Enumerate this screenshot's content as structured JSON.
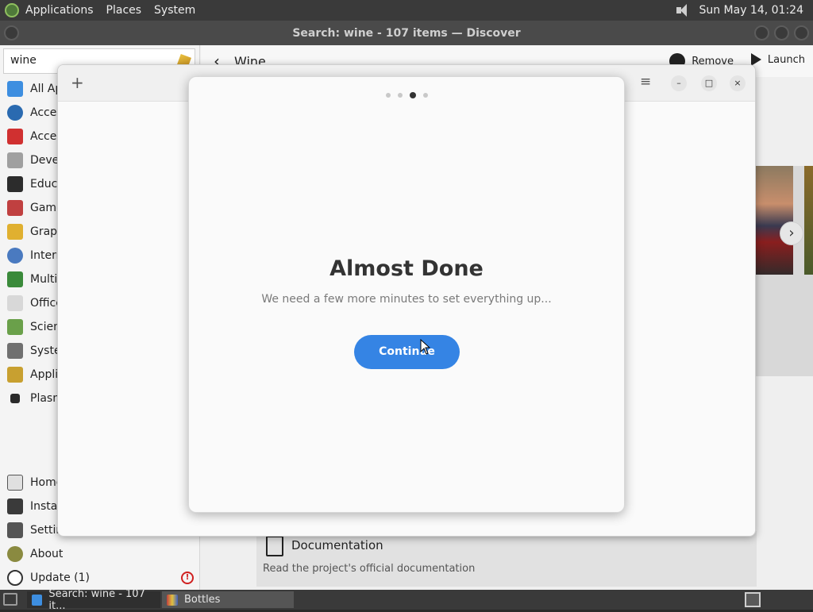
{
  "top_panel": {
    "menus": [
      "Applications",
      "Places",
      "System"
    ],
    "clock": "Sun May 14, 01:24"
  },
  "discover": {
    "window_title": "Search: wine - 107 items — Discover",
    "search_value": "wine",
    "categories": [
      "All Ap",
      "Acces",
      "Acces",
      "Devel",
      "Educa",
      "Game",
      "Graph",
      "Intern",
      "Multi",
      "Office",
      "Scien",
      "Systen",
      "Applic",
      "Plasm"
    ],
    "bottom_items": [
      "Home",
      "Instal",
      "Setting",
      "About",
      "Update (1)"
    ],
    "header": {
      "title": "Wine",
      "remove_label": "Remove",
      "launch_label": "Launch"
    },
    "documentation": {
      "title": "Documentation",
      "description": "Read the project's official documentation"
    }
  },
  "bottles": {
    "add_glyph": "+",
    "menu_glyph": "≡",
    "minimize_glyph": "–",
    "maximize_glyph": "□",
    "close_glyph": "×"
  },
  "dialog": {
    "page_count": 4,
    "active_page": 3,
    "title": "Almost Done",
    "subtitle": "We need a few more minutes to set everything up...",
    "continue_label": "Continue"
  },
  "taskbar": {
    "tasks": [
      "Search: wine - 107 it...",
      "Bottles"
    ]
  },
  "colors": {
    "accent": "#3584e4",
    "panel": "#3a3a3a"
  }
}
